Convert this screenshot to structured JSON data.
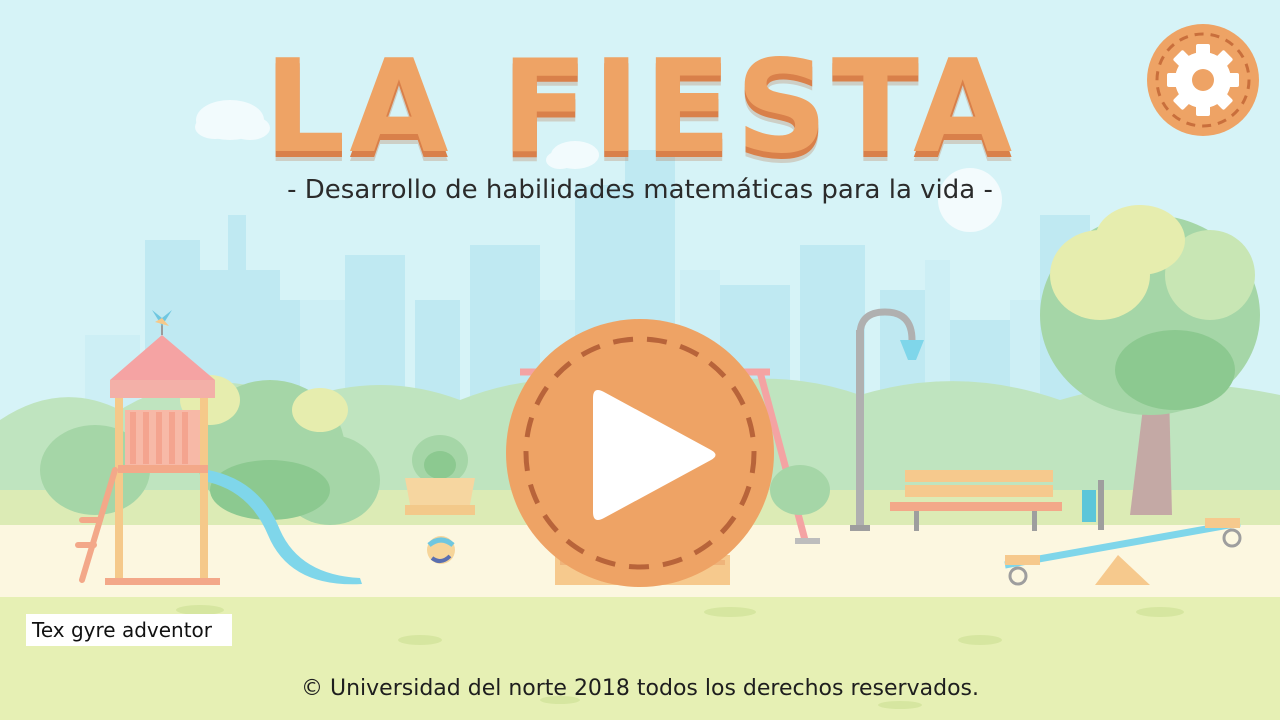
{
  "game": {
    "title": "LA FIESTA",
    "subtitle": "- Desarrollo de habilidades matemáticas para la vida -",
    "font_label": "Tex gyre adventor",
    "copyright": "© Universidad del norte 2018 todos los derechos reservados."
  },
  "buttons": {
    "play_icon": "play-icon",
    "settings_icon": "gear-icon"
  },
  "colors": {
    "accent": "#eea365",
    "accent_dark": "#d9804a",
    "sky": "#d6f3f7",
    "grass": "#e6f0b4",
    "path": "#fcf7e0"
  }
}
